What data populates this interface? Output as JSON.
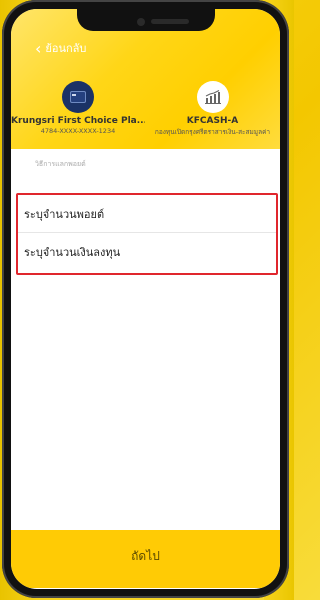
{
  "header": {
    "back_label": "ย้อนกลับ"
  },
  "accounts": {
    "left": {
      "title": "Krungsri First Choice Pla...",
      "subtitle": "4784-XXXX-XXXX-1234",
      "icon": "credit-card-icon"
    },
    "right": {
      "title": "KFCASH-A",
      "subtitle": "กองทุนเปิดกรุงศรีตราสารเงิน-สะสมมูลค่า",
      "icon": "fund-chart-icon"
    }
  },
  "redeem": {
    "section_label": "วิธีการแลกพอยต์",
    "options": [
      "ระบุจำนวนพอยต์",
      "ระบุจำนวนเงินลงทุน"
    ]
  },
  "footer": {
    "next_label": "ถัดไป"
  },
  "colors": {
    "accent": "#ffcb05",
    "highlight_border": "#e0262d",
    "card_icon_bg": "#1b3266"
  }
}
